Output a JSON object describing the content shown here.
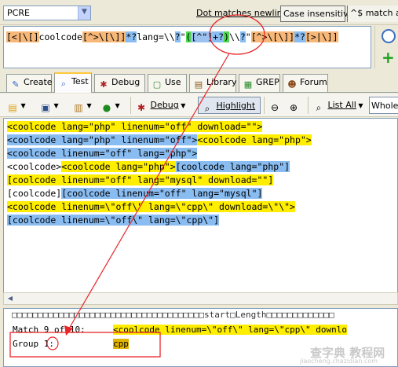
{
  "topbar": {
    "flavor": "PCRE",
    "dot_newline": "Dot matches newline",
    "case_insensitive": "Case insensitive",
    "match_at": "^$ match at"
  },
  "regex": {
    "segments": [
      {
        "t": "[<|\\[]",
        "c": "t-br"
      },
      {
        "t": "coolcode",
        "c": ""
      },
      {
        "t": "[^>\\[\\]]",
        "c": "t-br"
      },
      {
        "t": "*?",
        "c": "t-q"
      },
      {
        "t": "lang=\\\\",
        "c": ""
      },
      {
        "t": "?",
        "c": "t-q"
      },
      {
        "t": "\"",
        "c": ""
      },
      {
        "t": "(",
        "c": "t-grp"
      },
      {
        "t": "[^\"]",
        "c": "t-inner"
      },
      {
        "t": "+?",
        "c": "t-q"
      },
      {
        "t": ")",
        "c": "t-grp"
      },
      {
        "t": "\\\\",
        "c": ""
      },
      {
        "t": "?",
        "c": "t-q"
      },
      {
        "t": "\"",
        "c": ""
      },
      {
        "t": "[^>\\[\\]]",
        "c": "t-br"
      },
      {
        "t": "*?",
        "c": "t-q"
      },
      {
        "t": "[>|\\]]",
        "c": "t-br"
      }
    ]
  },
  "tabs": [
    {
      "label": "Create",
      "icon": "create-icon"
    },
    {
      "label": "Test",
      "icon": "test-search-icon"
    },
    {
      "label": "Debug",
      "icon": "debug-bug-icon"
    },
    {
      "label": "Use",
      "icon": "use-icon"
    },
    {
      "label": "Library",
      "icon": "library-icon"
    },
    {
      "label": "GREP",
      "icon": "grep-icon"
    },
    {
      "label": "Forum",
      "icon": "forum-icon"
    }
  ],
  "toolbar": {
    "debug": "Debug",
    "highlight": "Highlight",
    "list_all": "List All",
    "whole_line": "Whole l"
  },
  "subject": [
    [
      {
        "t": "<coolcode lang=\"php\" linenum=\"off\" download=\"\">",
        "c": "hy"
      }
    ],
    [
      {
        "t": "<coolcode lang=\"php\" linenum=\"off\">",
        "c": "hb"
      },
      {
        "t": "<coolcode lang=\"php\">",
        "c": "hy"
      }
    ],
    [
      {
        "t": "<coolcode linenum=\"off\" lang=\"php\">",
        "c": "hb"
      }
    ],
    [
      {
        "t": "<coolcode>",
        "c": ""
      },
      {
        "t": "<coolcode lang=\"php\">",
        "c": "hy"
      },
      {
        "t": "[coolcode lang=\"php\"]",
        "c": "hb"
      }
    ],
    [
      {
        "t": "[coolcode linenum=\"off\" lang=\"mysql\" download=\"\"]",
        "c": "hy"
      }
    ],
    [
      {
        "t": "[coolcode]",
        "c": ""
      },
      {
        "t": "[coolcode linenum=\"off\" lang=\"mysql\"]",
        "c": "hb"
      }
    ],
    [
      {
        "t": "<coolcode linenum=\\\"off\\\" lang=\\\"cpp\\\" download=\\\"\\\">",
        "c": "hy"
      }
    ],
    [
      {
        "t": "[coolcode linenum=\\\"off\\\" lang=\\\"cpp\\\"]",
        "c": "hb"
      }
    ]
  ],
  "results": {
    "header": "□□□□□□□□□□□□□□□□□□□□□□□□□□□□□□□□□□□□□start□Length□□□□□□□□□□□□□",
    "match_label": "Match 9 of 10:",
    "match_value": "<coolcode linenum=\\\"off\\\" lang=\\\"cpp\\\" downlo",
    "group_label": "Group 1:",
    "group_value": "cpp"
  },
  "watermark": {
    "text": "查字典 教程网",
    "url": "jiaocheng.chazidian.com"
  },
  "colors": {
    "highlight_yellow": "#ffee00",
    "highlight_blue": "#89bdf2",
    "annotation_red": "#e8262a",
    "group_green": "#4bd64b"
  }
}
